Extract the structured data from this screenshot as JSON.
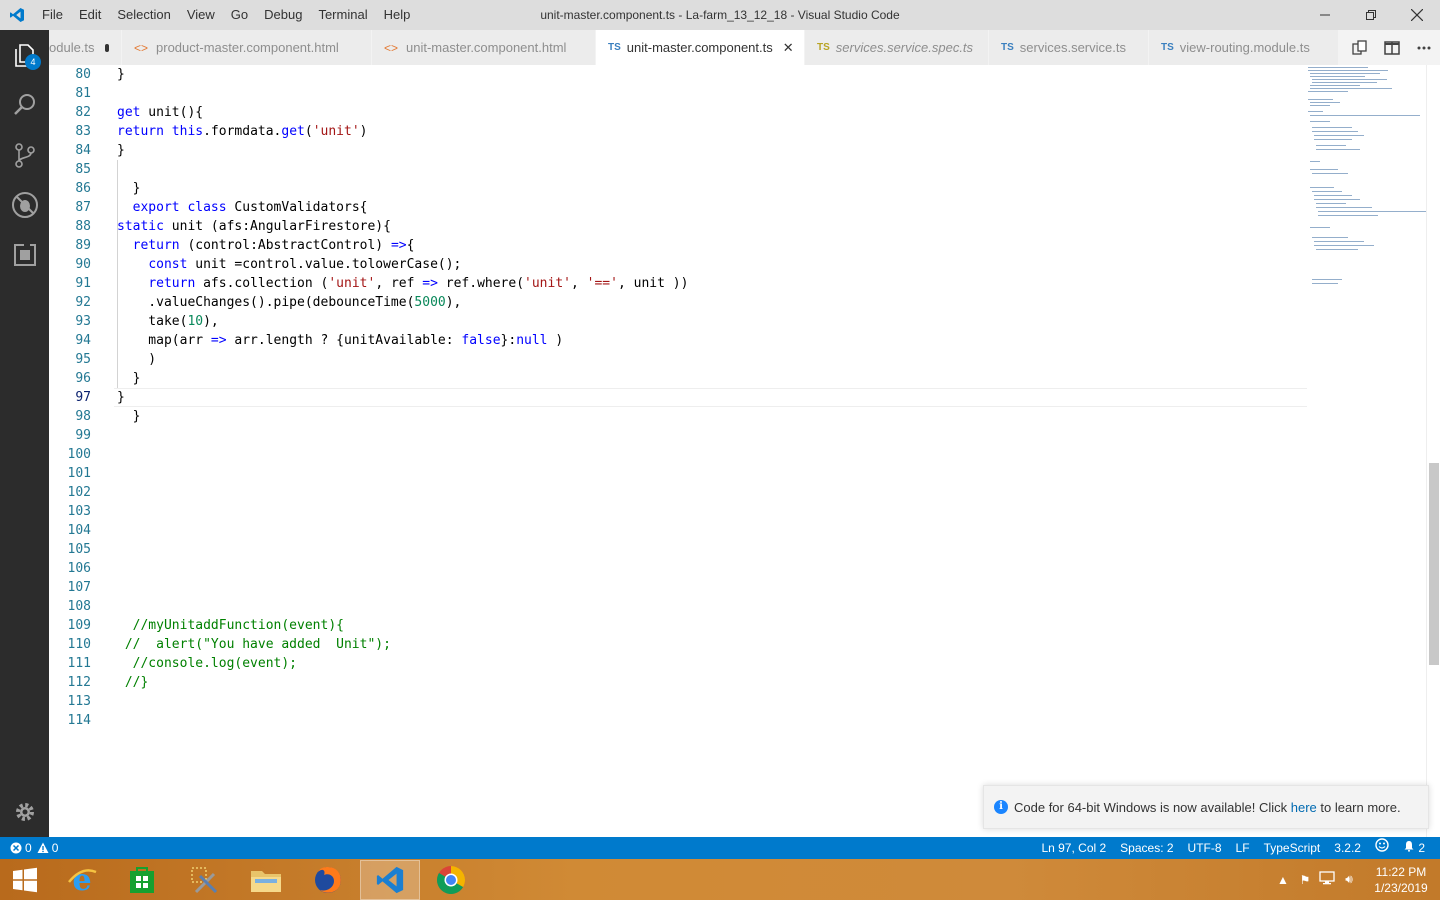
{
  "window": {
    "title": "unit-master.component.ts - La-farm_13_12_18 - Visual Studio Code",
    "controls": [
      "minimize",
      "restore",
      "close"
    ]
  },
  "menu": [
    "File",
    "Edit",
    "Selection",
    "View",
    "Go",
    "Debug",
    "Terminal",
    "Help"
  ],
  "activity_bar": {
    "explorer_badge": "4"
  },
  "tabs": [
    {
      "label": "odule.ts",
      "kind": "ts",
      "state": "dirty"
    },
    {
      "label": "product-master.component.html",
      "kind": "html"
    },
    {
      "label": "unit-master.component.html",
      "kind": "html"
    },
    {
      "label": "unit-master.component.ts",
      "kind": "ts",
      "state": "active"
    },
    {
      "label": "services.service.spec.ts",
      "kind": "ts-spec",
      "italic": true
    },
    {
      "label": "services.service.ts",
      "kind": "ts"
    },
    {
      "label": "view-routing.module.ts",
      "kind": "ts"
    }
  ],
  "ts_prefix": "TS",
  "editor": {
    "lines": [
      {
        "n": "80",
        "text": "}"
      },
      {
        "n": "81",
        "text": ""
      },
      {
        "n": "82",
        "text": "get unit(){"
      },
      {
        "n": "83",
        "text": "return this.formdata.get('unit')"
      },
      {
        "n": "84",
        "text": "}"
      },
      {
        "n": "85",
        "text": ""
      },
      {
        "n": "86",
        "text": "  }"
      },
      {
        "n": "87",
        "text": "  export class CustomValidators{"
      },
      {
        "n": "88",
        "text": "static unit (afs:AngularFirestore){"
      },
      {
        "n": "89",
        "text": "  return (control:AbstractControl) =>{"
      },
      {
        "n": "90",
        "text": "    const unit =control.value.tolowerCase();"
      },
      {
        "n": "91",
        "text": "    return afs.collection ('unit', ref => ref.where('unit', '==', unit ))"
      },
      {
        "n": "92",
        "text": "    .valueChanges().pipe(debounceTime(5000),"
      },
      {
        "n": "93",
        "text": "    take(10),"
      },
      {
        "n": "94",
        "text": "    map(arr => arr.length ? {unitAvailable: false}:null )"
      },
      {
        "n": "95",
        "text": "    )"
      },
      {
        "n": "96",
        "text": "  }"
      },
      {
        "n": "97",
        "text": "}"
      },
      {
        "n": "98",
        "text": "  }"
      },
      {
        "n": "99",
        "text": ""
      },
      {
        "n": "100",
        "text": ""
      },
      {
        "n": "101",
        "text": ""
      },
      {
        "n": "102",
        "text": ""
      },
      {
        "n": "103",
        "text": ""
      },
      {
        "n": "104",
        "text": ""
      },
      {
        "n": "105",
        "text": ""
      },
      {
        "n": "106",
        "text": ""
      },
      {
        "n": "107",
        "text": ""
      },
      {
        "n": "108",
        "text": ""
      },
      {
        "n": "109",
        "text": "  //myUnitaddFunction(event){"
      },
      {
        "n": "110",
        "text": " //  alert(\"You have added  Unit\");"
      },
      {
        "n": "111",
        "text": "  //console.log(event);"
      },
      {
        "n": "112",
        "text": " //}"
      },
      {
        "n": "113",
        "text": ""
      },
      {
        "n": "114",
        "text": ""
      }
    ],
    "current_line": "97"
  },
  "notification": {
    "before": "Code for 64-bit Windows is now available! Click ",
    "link": "here",
    "after": " to learn more."
  },
  "statusbar": {
    "errors": "0",
    "warnings": "0",
    "position": "Ln 97, Col 2",
    "spaces": "Spaces: 2",
    "encoding": "UTF-8",
    "eol": "LF",
    "language": "TypeScript",
    "version": "3.2.2",
    "notifications": "2"
  },
  "taskbar": {
    "apps": [
      "internet-explorer",
      "store",
      "tools",
      "file-explorer",
      "firefox",
      "vscode",
      "chrome"
    ],
    "active_app": "vscode",
    "time": "11:22 PM",
    "date": "1/23/2019"
  },
  "colors": {
    "accent": "#007acc",
    "keyword": "#0000ff",
    "string": "#a31515",
    "number": "#09885a",
    "comment": "#008000",
    "line_number": "#237893"
  }
}
